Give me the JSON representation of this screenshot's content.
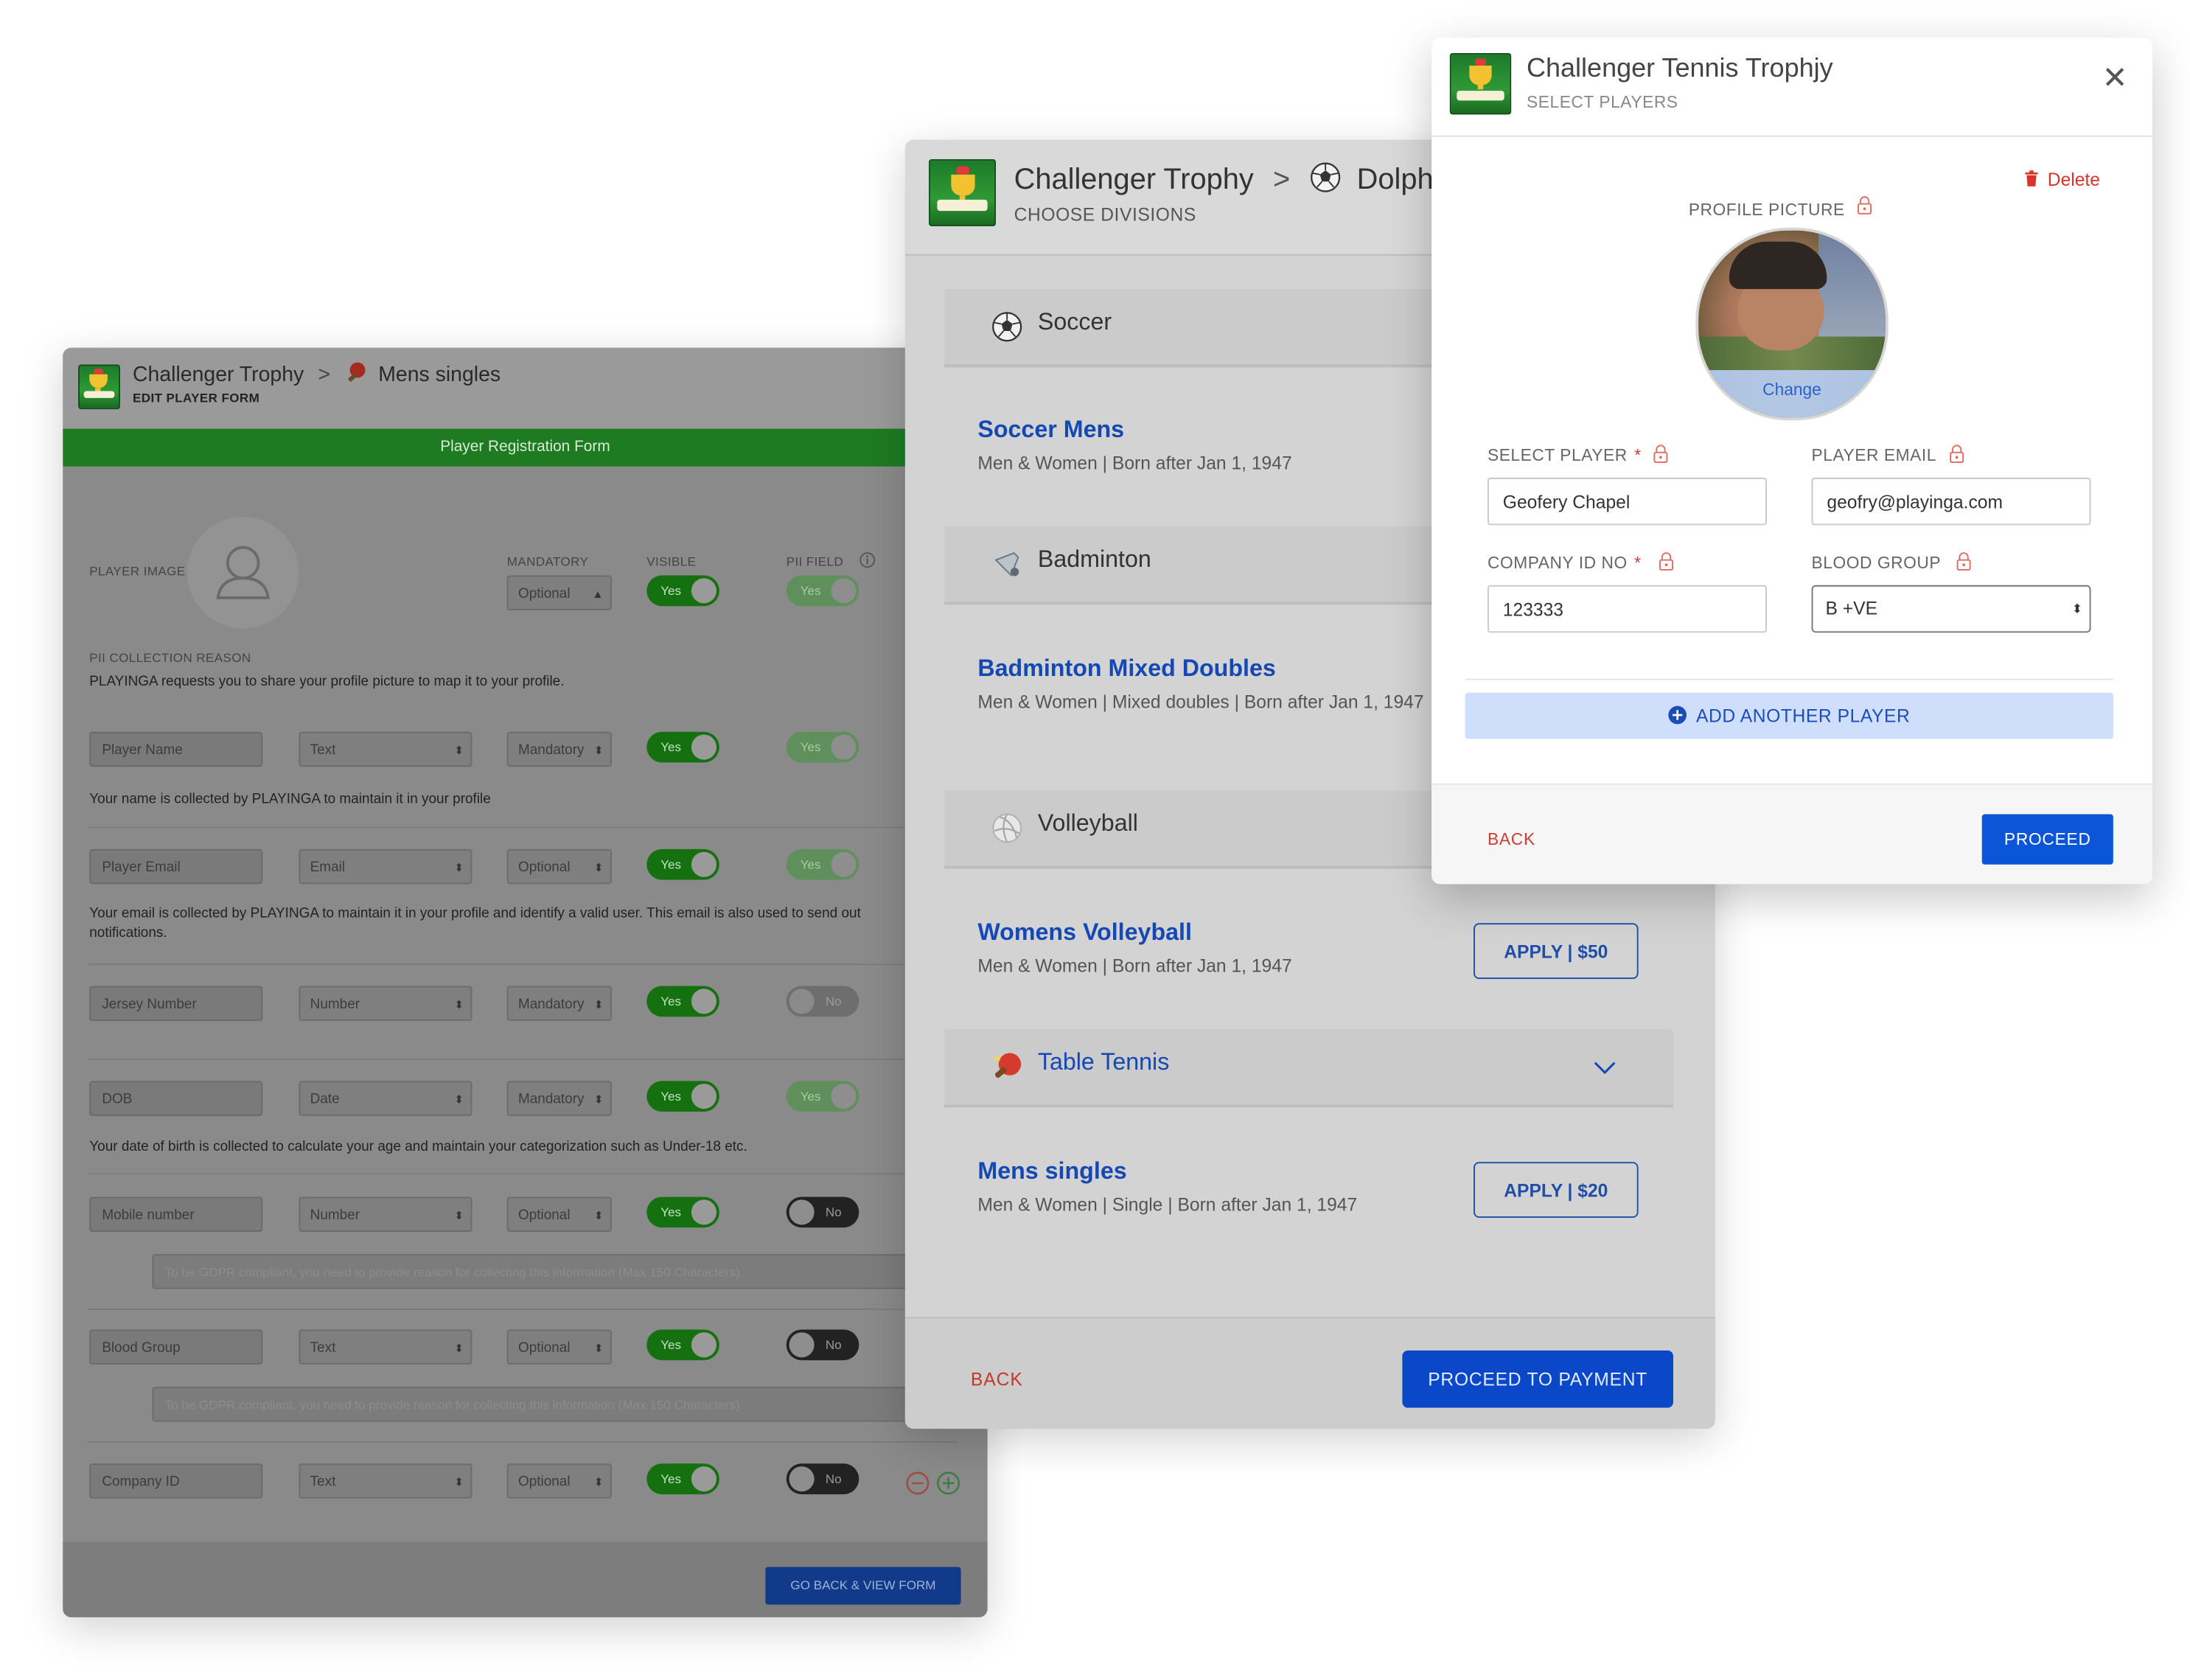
{
  "colors": {
    "accent_blue": "#0b55d9",
    "form_green": "#1e7b22",
    "danger_red": "#d8342c"
  },
  "edit_form": {
    "title": "Challenger Trophy",
    "breadcrumb_sep": ">",
    "event": "Mens singles",
    "subtitle": "EDIT PLAYER FORM",
    "banner": "Player Registration Form",
    "player_image_label": "PLAYER IMAGE",
    "col_mandatory": "MANDATORY",
    "col_visible": "VISIBLE",
    "col_pii": "PII FIELD",
    "image_mandatory": "Optional",
    "pii_reason_label": "PII COLLECTION REASON",
    "pii_reason_text": "PLAYINGA requests you to share your profile picture to map it to your profile.",
    "fields": [
      {
        "name": "Player Name",
        "type": "Text",
        "req": "Mandatory",
        "visible": "Yes",
        "pii": "Yes",
        "note": "Your name is collected by PLAYINGA to maintain it in your profile"
      },
      {
        "name": "Player Email",
        "type": "Email",
        "req": "Optional",
        "visible": "Yes",
        "pii": "Yes",
        "note": "Your email is collected by PLAYINGA to maintain it in your profile and identify a valid user. This email is also used to send out notifications."
      },
      {
        "name": "Jersey Number",
        "type": "Number",
        "req": "Mandatory",
        "visible": "Yes",
        "pii": "No",
        "note": ""
      },
      {
        "name": "DOB",
        "type": "Date",
        "req": "Mandatory",
        "visible": "Yes",
        "pii": "Yes",
        "note": "Your date of birth is collected to calculate your age and maintain your categorization such as Under-18 etc."
      },
      {
        "name": "Mobile number",
        "type": "Number",
        "req": "Optional",
        "visible": "Yes",
        "pii": "No",
        "note": ""
      },
      {
        "name": "Blood Group",
        "type": "Text",
        "req": "Optional",
        "visible": "Yes",
        "pii": "No",
        "note": ""
      },
      {
        "name": "Company ID",
        "type": "Text",
        "req": "Optional",
        "visible": "Yes",
        "pii": "No",
        "note": ""
      }
    ],
    "gdpr_placeholder": "To be GDPR compliant, you need to provide reason for collecting this information (Max 150 Characters)",
    "go_back_button": "GO BACK & VIEW FORM"
  },
  "divisions": {
    "title": "Challenger Trophy",
    "breadcrumb_sep": ">",
    "club": "Dolph",
    "subtitle": "CHOOSE DIVISIONS",
    "sports": [
      {
        "name": "Soccer",
        "icon": "soccer-ball-icon"
      },
      {
        "name": "Badminton",
        "icon": "shuttlecock-icon"
      },
      {
        "name": "Volleyball",
        "icon": "volleyball-icon"
      },
      {
        "name": "Table Tennis",
        "icon": "ping-pong-paddle-icon"
      }
    ],
    "division_list": [
      {
        "title": "Soccer Mens",
        "desc": "Men & Women | Born after Jan 1, 1947",
        "apply": ""
      },
      {
        "title": "Badminton Mixed Doubles",
        "desc": "Men & Women | Mixed doubles | Born after Jan 1, 1947",
        "apply": ""
      },
      {
        "title": "Womens Volleyball",
        "desc": "Men & Women | Born after Jan 1, 1947",
        "apply": "APPLY | $50"
      },
      {
        "title": "Mens singles",
        "desc": "Men & Women | Single | Born after Jan 1, 1947",
        "apply": "APPLY | $20"
      }
    ],
    "back": "BACK",
    "proceed": "PROCEED TO PAYMENT"
  },
  "select_players": {
    "title": "Challenger Tennis Trophjy",
    "subtitle": "SELECT PLAYERS",
    "close_glyph": "✕",
    "delete": "Delete",
    "profile_label": "PROFILE PICTURE",
    "change": "Change",
    "select_player_label": "SELECT PLAYER",
    "select_player_value": "Geofery Chapel",
    "email_label": "PLAYER EMAIL",
    "email_value": "geofry@playinga.com",
    "company_label": "COMPANY ID NO",
    "company_value": "123333",
    "blood_label": "BLOOD GROUP",
    "blood_value": "B +VE",
    "required_mark": "*",
    "add_another": "ADD ANOTHER PLAYER",
    "back": "BACK",
    "proceed": "PROCEED"
  }
}
